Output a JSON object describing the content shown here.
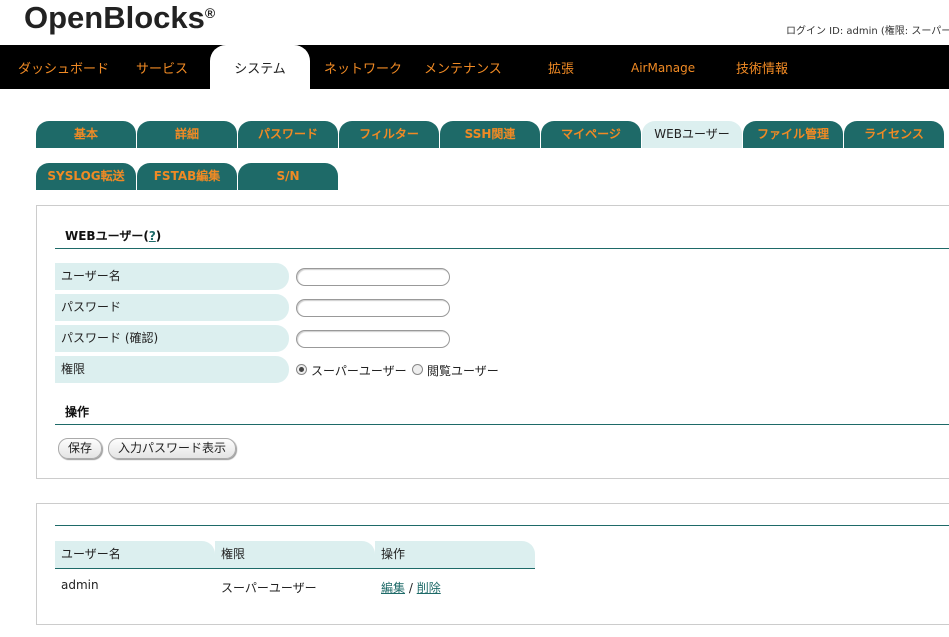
{
  "header": {
    "logo": "OpenBlocks",
    "logo_mark": "®",
    "login_info": "ログイン ID: admin (権限: スーパーユ"
  },
  "topnav": {
    "items": [
      "ダッシュボード",
      "サービス",
      "システム",
      "ネットワーク",
      "メンテナンス",
      "拡張",
      "AirManage",
      "技術情報"
    ],
    "active": "システム"
  },
  "tabs": {
    "row1": [
      "基本",
      "詳細",
      "パスワード",
      "フィルター",
      "SSH関連",
      "マイページ",
      "WEBユーザー",
      "ファイル管理",
      "ライセンス"
    ],
    "row2": [
      "SYSLOG転送",
      "FSTAB編集",
      "S/N"
    ],
    "active": "WEBユーザー"
  },
  "form": {
    "title": "WEBユーザー",
    "title_open": "(",
    "help": "?",
    "title_close": ")",
    "fields": {
      "username_label": "ユーザー名",
      "username_value": "",
      "password_label": "パスワード",
      "password_value": "",
      "password_confirm_label": "パスワード (確認)",
      "password_confirm_value": "",
      "permission_label": "権限"
    },
    "permission_options": {
      "super_user": "スーパーユーザー",
      "view_user": "閲覧ユーザー",
      "selected": "スーパーユーザー"
    },
    "operations_title": "操作",
    "save_button": "保存",
    "show_password_button": "入力パスワード表示"
  },
  "user_table": {
    "columns": [
      "ユーザー名",
      "権限",
      "操作"
    ],
    "rows": [
      {
        "username": "admin",
        "permission": "スーパーユーザー",
        "edit": "編集",
        "separator": "/",
        "delete": "削除"
      }
    ]
  },
  "colors": {
    "accent_teal": "#1e6a68",
    "accent_orange": "#f08a24",
    "label_bg": "#dcefef",
    "nav_bg": "#000000"
  }
}
